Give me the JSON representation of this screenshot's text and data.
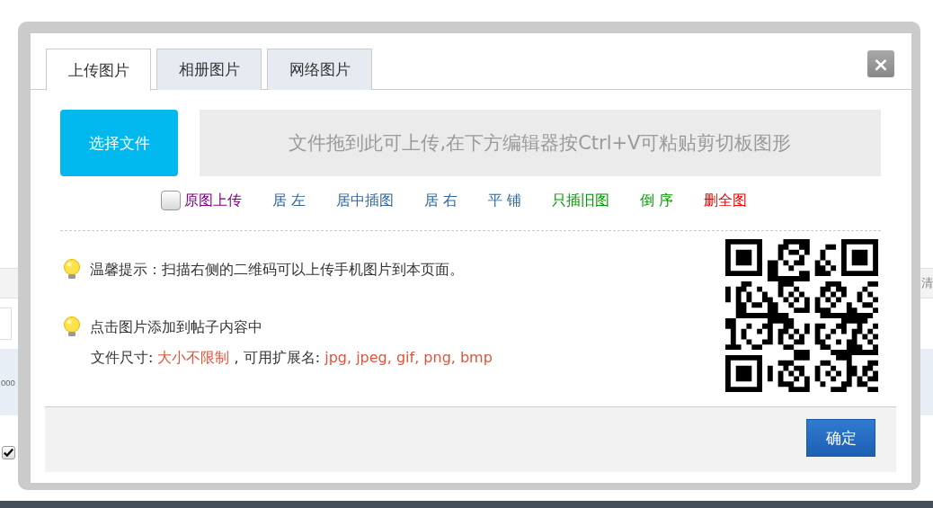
{
  "background_page": {
    "right_label": "清",
    "left_value": "000",
    "checkbox": {
      "checked": true
    }
  },
  "dialog": {
    "tabs": [
      {
        "label": "上传图片",
        "selected": true
      },
      {
        "label": "相册图片",
        "selected": false
      },
      {
        "label": "网络图片",
        "selected": false
      }
    ],
    "close_button": "×",
    "choose_button": "选择文件",
    "drop_zone": "文件拖到此可上传,在下方编辑器按Ctrl+V可粘贴剪切板图形",
    "options": [
      {
        "kind": "checkbox",
        "label": "原图上传",
        "checked": false,
        "color": "#800080"
      },
      {
        "kind": "link",
        "label": "居 左",
        "color": "#336699"
      },
      {
        "kind": "link",
        "label": "居中插图",
        "color": "#336699"
      },
      {
        "kind": "link",
        "label": "居 右",
        "color": "#336699"
      },
      {
        "kind": "link",
        "label": "平 铺",
        "color": "#336699"
      },
      {
        "kind": "link",
        "label": "只插旧图",
        "color": "#009900"
      },
      {
        "kind": "link",
        "label": "倒 序",
        "color": "#009900"
      },
      {
        "kind": "link",
        "label": "删全图",
        "color": "#ee0000"
      }
    ],
    "tips": [
      {
        "text": "温馨提示：扫描右侧的二维码可以上传手机图片到本页面。"
      },
      {
        "text": "点击图片添加到帖子内容中"
      }
    ],
    "file_info": [
      {
        "text": "文件尺寸: ",
        "highlight": false
      },
      {
        "text": "大小不限制",
        "highlight": true
      },
      {
        "text": " , 可用扩展名: ",
        "highlight": false
      },
      {
        "text": "jpg, jpeg, gif, png, bmp",
        "highlight": true
      }
    ],
    "confirm_button": "确定"
  }
}
